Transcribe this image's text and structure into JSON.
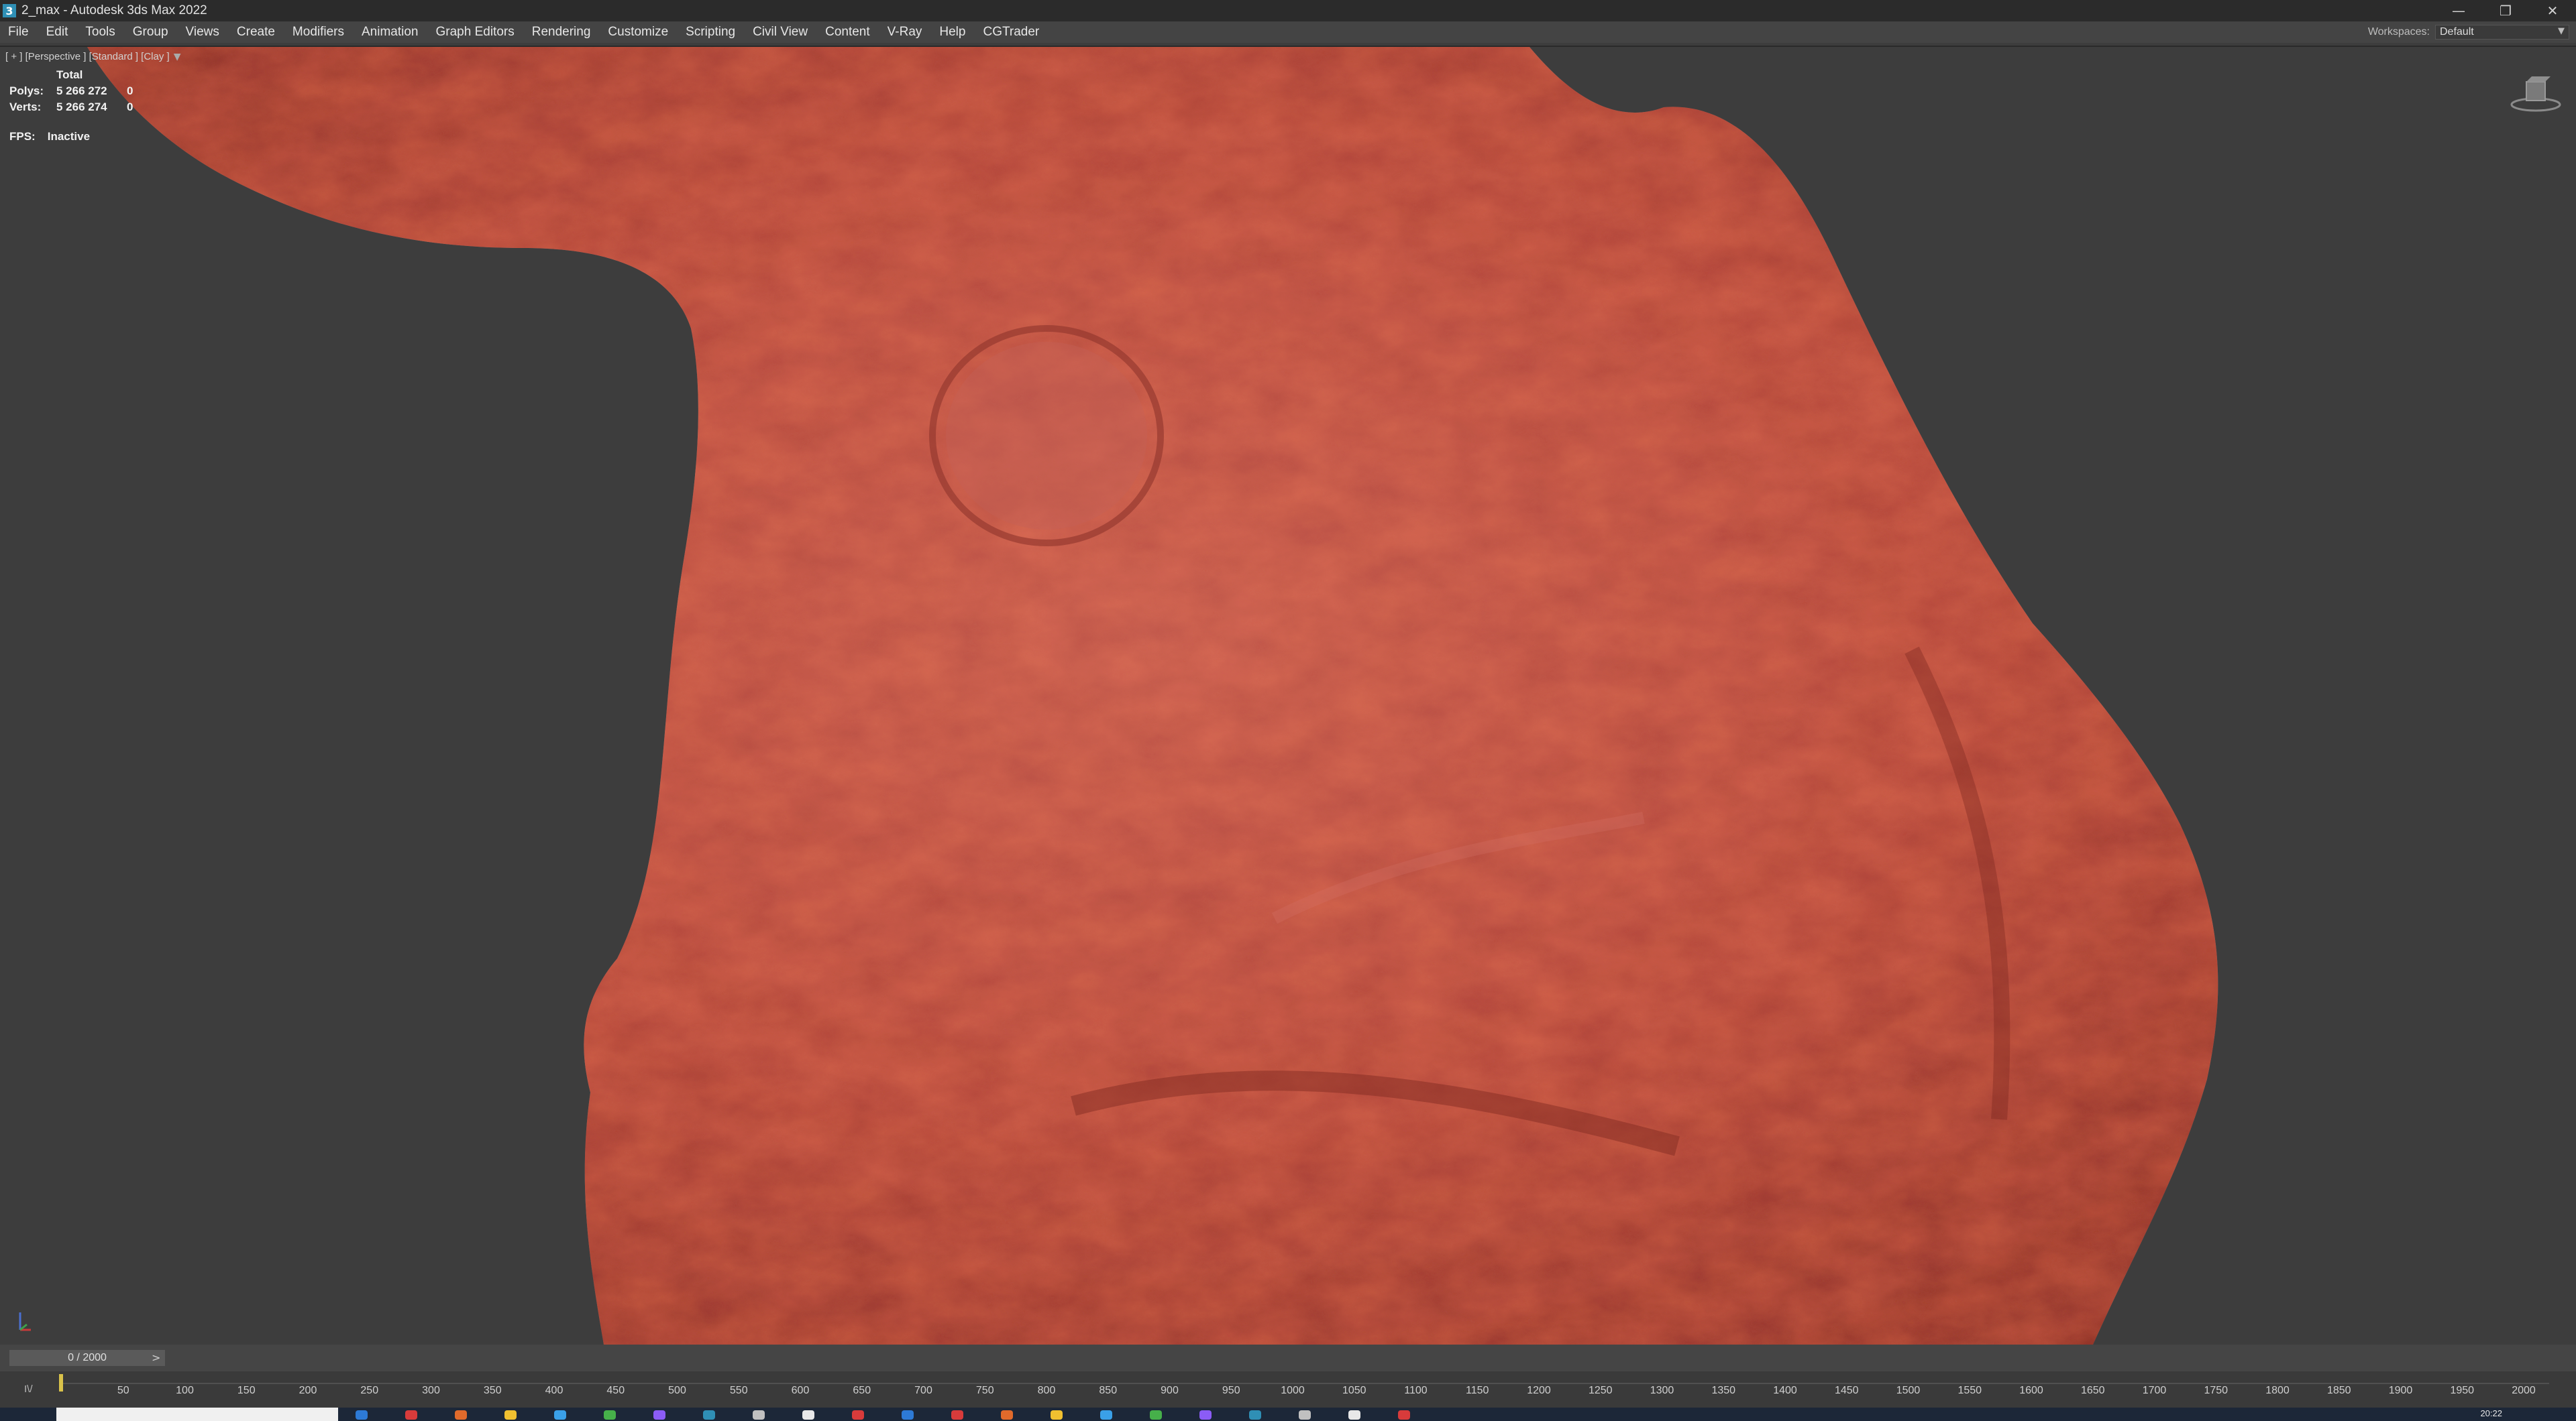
{
  "titlebar": {
    "title": "2_max - Autodesk 3ds Max 2022",
    "app_icon_glyph": "3",
    "minimize_glyph": "—",
    "restore_glyph": "❐",
    "close_glyph": "✕"
  },
  "menu": {
    "items": [
      "File",
      "Edit",
      "Tools",
      "Group",
      "Views",
      "Create",
      "Modifiers",
      "Animation",
      "Graph Editors",
      "Rendering",
      "Customize",
      "Scripting",
      "Civil View",
      "Content",
      "V-Ray",
      "Help",
      "CGTrader"
    ]
  },
  "workspaces": {
    "label": "Workspaces:",
    "value": "Default"
  },
  "viewport": {
    "label": "[ + ] [Perspective ] [Standard ] [Clay ]",
    "stats": {
      "header": "Total",
      "polys_label": "Polys:",
      "polys_value": "5 266 272",
      "polys_selected": "0",
      "verts_label": "Verts:",
      "verts_value": "5 266 274",
      "verts_selected": "0"
    },
    "fps_label": "FPS:",
    "fps_value": "Inactive",
    "mesh_color": "#b8443a",
    "background_color": "#3d3d3d"
  },
  "timeline": {
    "frame_display": "0 / 2000",
    "ticks": [
      "50",
      "100",
      "150",
      "200",
      "250",
      "300",
      "350",
      "400",
      "450",
      "500",
      "550",
      "600",
      "650",
      "700",
      "750",
      "800",
      "850",
      "900",
      "950",
      "1000",
      "1050",
      "1100",
      "1150",
      "1200",
      "1250",
      "1300",
      "1350",
      "1400",
      "1450",
      "1500",
      "1550",
      "1600",
      "1650",
      "1700",
      "1750",
      "1800",
      "1850",
      "1900",
      "1950",
      "2000"
    ]
  },
  "taskbar": {
    "clock": "20:22"
  }
}
